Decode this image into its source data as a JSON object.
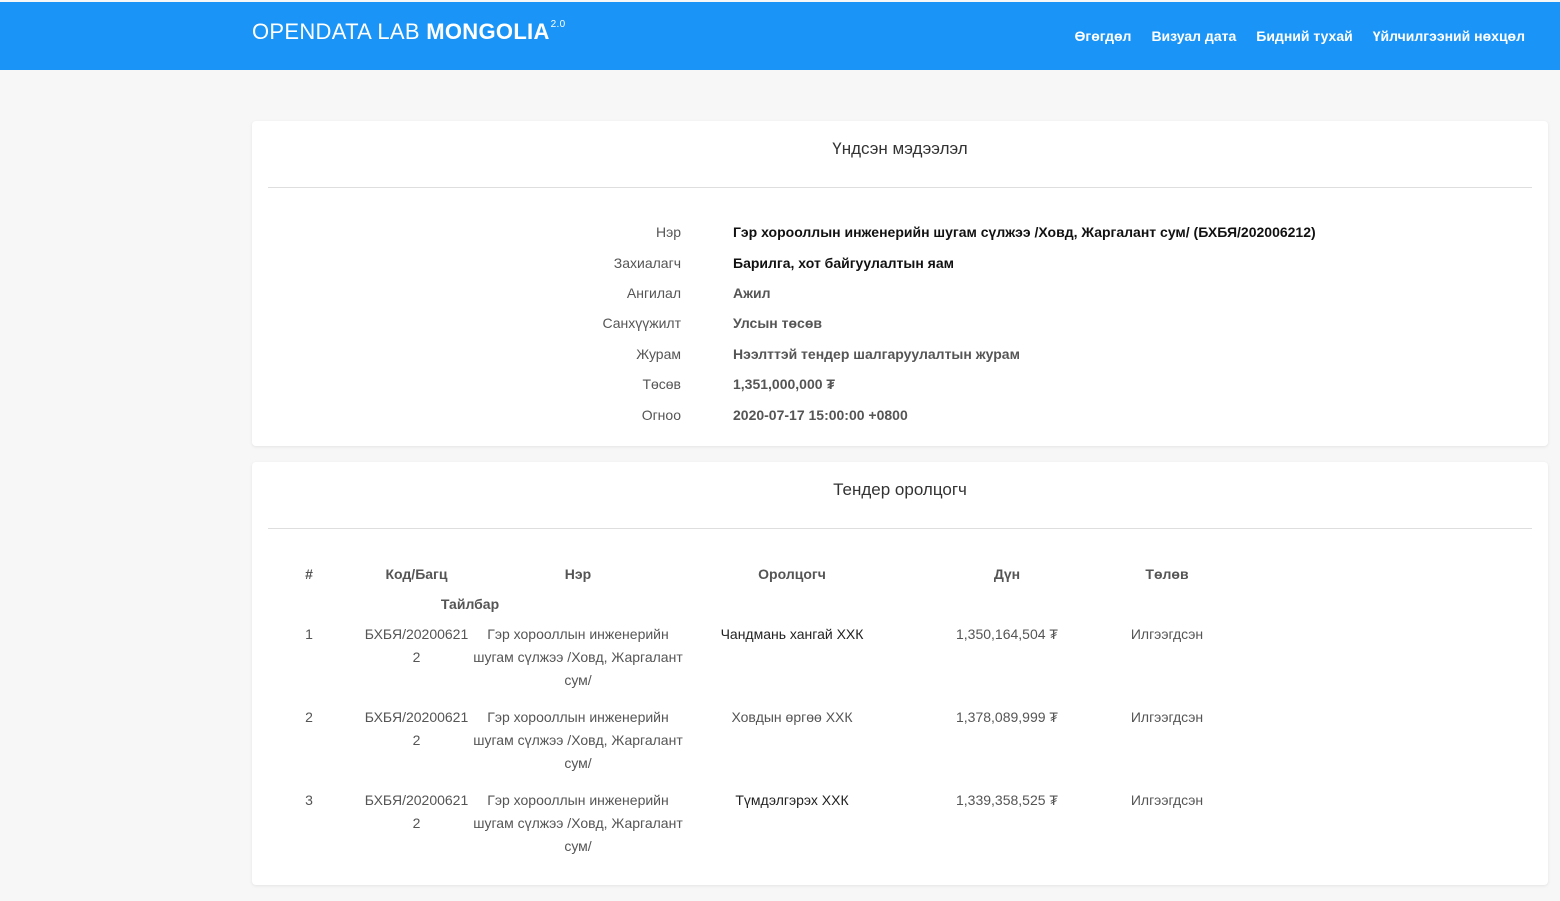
{
  "header": {
    "logo_prefix": "OPENDATA LAB",
    "logo_main": "MONGOLIA",
    "logo_version": "2.0",
    "nav": [
      {
        "label": "Өгөгдөл"
      },
      {
        "label": "Визуал дата"
      },
      {
        "label": "Бидний тухай"
      },
      {
        "label": "Үйлчилгээний нөхцөл"
      }
    ],
    "bar_color": "#1a94f6"
  },
  "basic_info": {
    "title": "Үндсэн мэдээлэл",
    "rows": [
      {
        "label": "Нэр",
        "value": "Гэр хорооллын инженерийн шугам сүлжээ /Ховд, Жаргалант сум/ (БХБЯ/202006212)"
      },
      {
        "label": "Захиалагч",
        "value": "Барилга, хот байгуулалтын яам"
      },
      {
        "label": "Ангилал",
        "value": "Ажил"
      },
      {
        "label": "Санхүүжилт",
        "value": "Улсын төсөв"
      },
      {
        "label": "Журам",
        "value": "Нээлттэй тендер шалгаруулалтын журам"
      },
      {
        "label": "Төсөв",
        "value": "1,351,000,000 ₮"
      },
      {
        "label": "Огноо",
        "value": "2020-07-17 15:00:00 +0800"
      }
    ]
  },
  "bidders": {
    "title": "Тендер оролцогч",
    "columns": {
      "index": "#",
      "code": "Код/Багц",
      "name": "Нэр",
      "bidder": "Оролцогч",
      "amount": "Дүн",
      "status": "Төлөв",
      "note": "Тайлбар"
    },
    "rows": [
      {
        "index": "1",
        "code": "БХБЯ/202006212",
        "name": "Гэр хорооллын инженерийн шугам сүлжээ /Ховд, Жаргалант сум/",
        "bidder": "Чандмань хангай ХХК",
        "amount": "1,350,164,504 ₮",
        "status": "Илгээгдсэн"
      },
      {
        "index": "2",
        "code": "БХБЯ/202006212",
        "name": "Гэр хорооллын инженерийн шугам сүлжээ /Ховд, Жаргалант сум/",
        "bidder": "Ховдын өргөө ХХК",
        "amount": "1,378,089,999 ₮",
        "status": "Илгээгдсэн"
      },
      {
        "index": "3",
        "code": "БХБЯ/202006212",
        "name": "Гэр хорооллын инженерийн шугам сүлжээ /Ховд, Жаргалант сум/",
        "bidder": "Түмдэлгэрэх ХХК",
        "amount": "1,339,358,525 ₮",
        "status": "Илгээгдсэн"
      }
    ]
  }
}
